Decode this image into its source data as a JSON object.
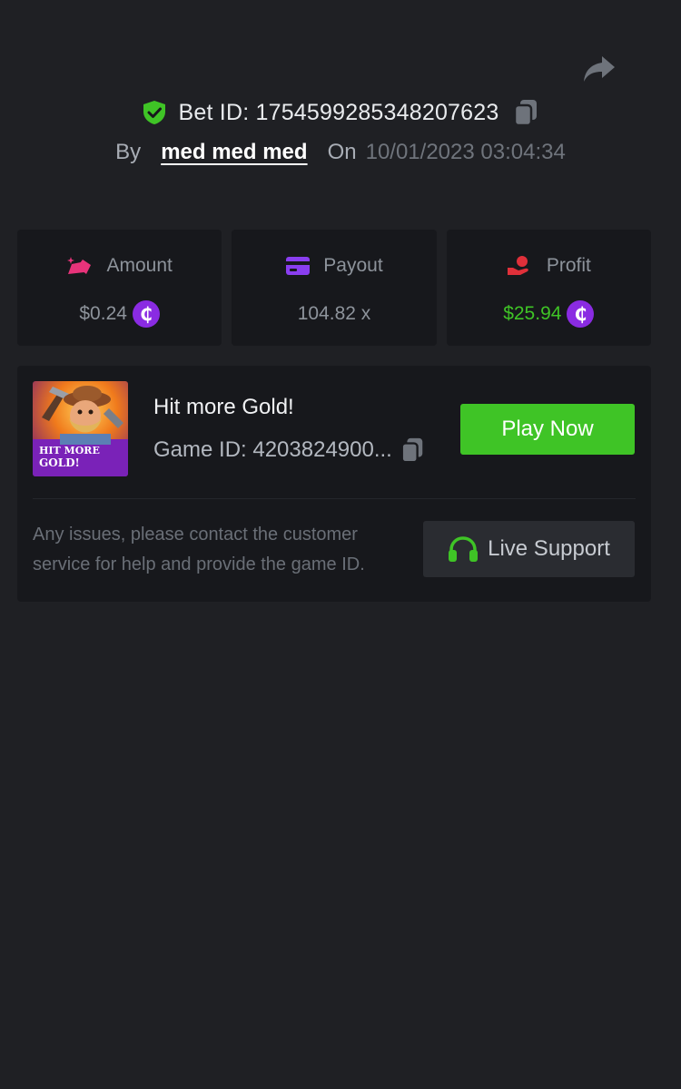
{
  "header": {
    "bet_id": "Bet ID: 1754599285348207623",
    "by_label": "By",
    "username": "med med med",
    "on_label": "On",
    "datetime": "10/01/2023 03:04:34"
  },
  "stats": {
    "amount": {
      "label": "Amount",
      "value": "$0.24"
    },
    "payout": {
      "label": "Payout",
      "value": "104.82 x"
    },
    "profit": {
      "label": "Profit",
      "value": "$25.94"
    }
  },
  "game": {
    "title": "Hit more Gold!",
    "game_id": "Game ID: 4203824900...",
    "thumbnail_text": "HIT MORE GOLD!",
    "play_label": "Play Now"
  },
  "support": {
    "help_text": "Any issues, please contact the customer service for help and provide the game ID.",
    "button_label": "Live Support"
  },
  "colors": {
    "background": "#1f2024",
    "card": "#17181c",
    "accent_green": "#3fc426",
    "coin_purple": "#8a2be2",
    "amount_icon": "#e8337a",
    "payout_icon": "#8a3ef0",
    "profit_icon": "#e0303a"
  },
  "icons": [
    "share-icon",
    "shield-check-icon",
    "copy-icon",
    "coins-icon",
    "card-icon",
    "hand-coin-icon",
    "coin-icon",
    "headset-icon"
  ]
}
